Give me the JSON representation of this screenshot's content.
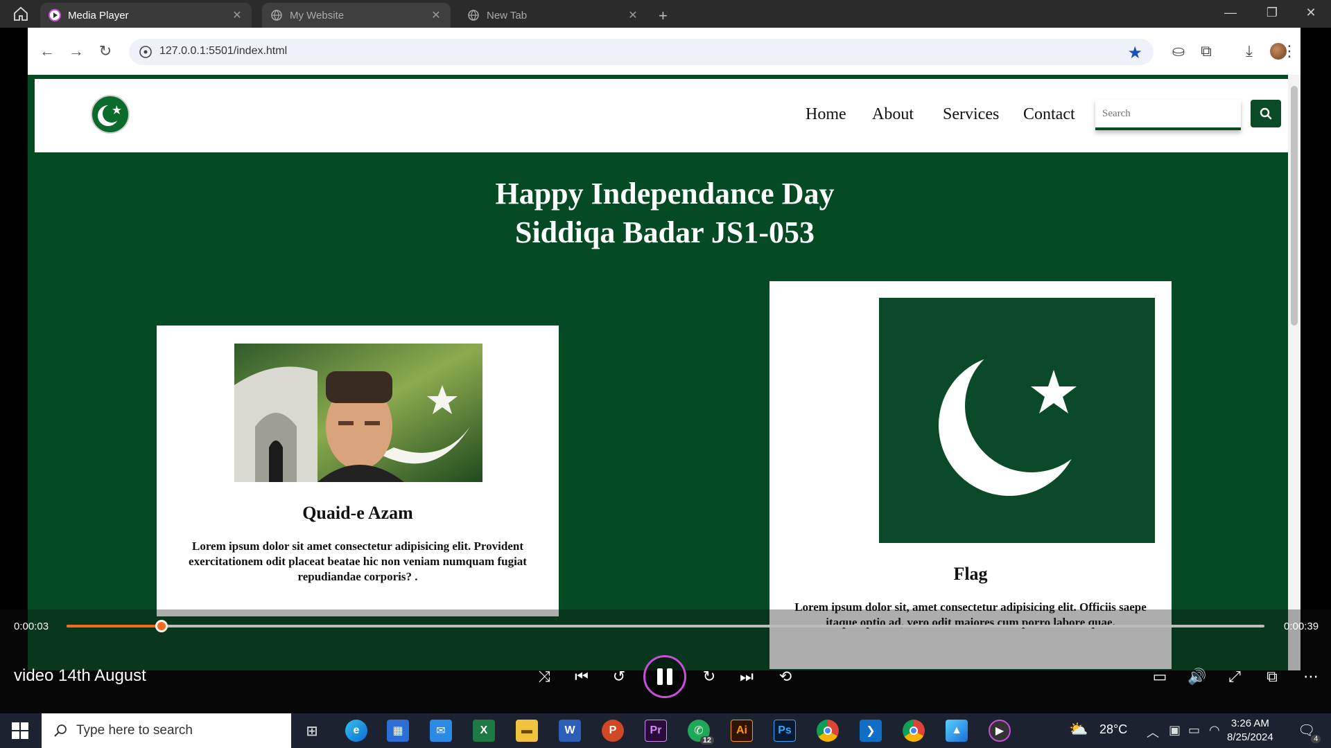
{
  "titlebar": {
    "tabs": [
      {
        "label": "Media Player"
      },
      {
        "label": "My Website"
      },
      {
        "label": "New Tab"
      }
    ]
  },
  "browser": {
    "url": "127.0.0.1:5501/index.html"
  },
  "site": {
    "nav": [
      "Home",
      "About",
      "Services",
      "Contact"
    ],
    "search_placeholder": "Search",
    "hero_line1": "Happy Independance Day",
    "hero_line2": "Siddiqa Badar JS1-053",
    "cards": [
      {
        "title": "Quaid-e Azam",
        "text": "Lorem ipsum dolor sit amet consectetur adipisicing elit. Provident exercitationem odit placeat beatae hic non veniam numquam fugiat repudiandae corporis? ."
      },
      {
        "title": "Flag",
        "text": "Lorem ipsum dolor sit, amet consectetur adipisicing elit. Officiis saepe itaque optio ad, vero odit maiores cum porro labore quae."
      }
    ]
  },
  "player": {
    "current_time": "0:00:03",
    "total_time": "0:00:39",
    "progress_fraction": 0.079,
    "video_title": "video 14th August",
    "accent_color": "#f36b20"
  },
  "taskbar": {
    "search_placeholder": "Type here to search",
    "weather": "28°C",
    "time": "3:26 AM",
    "date": "8/25/2024",
    "badges": {
      "whatsapp": "12",
      "notifications": "4"
    },
    "apps": [
      "edge-icon",
      "store-icon",
      "mail-icon",
      "excel-icon",
      "explorer-icon",
      "word-icon",
      "powerpoint-icon",
      "premiere-icon",
      "whatsapp-icon",
      "illustrator-icon",
      "photoshop-icon",
      "chrome-icon",
      "vscode-icon",
      "chrome-profile-icon",
      "photos-icon",
      "media-player-icon"
    ]
  }
}
